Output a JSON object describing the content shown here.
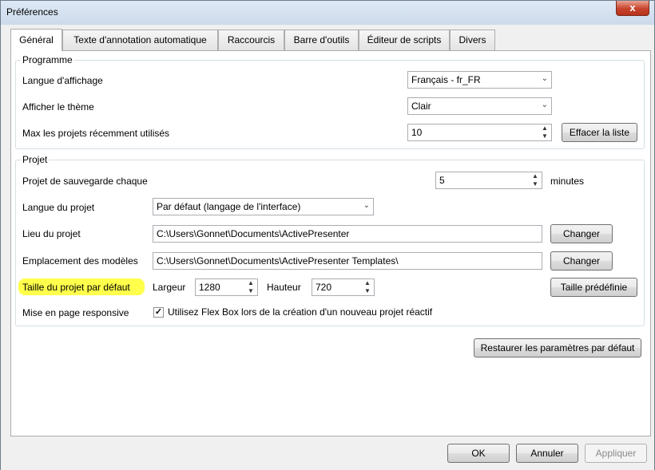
{
  "window": {
    "title": "Préférences",
    "close_glyph": "x"
  },
  "tabs": [
    {
      "label": "Général",
      "active": true
    },
    {
      "label": "Texte d'annotation automatique",
      "active": false
    },
    {
      "label": "Raccourcis",
      "active": false
    },
    {
      "label": "Barre d'outils",
      "active": false
    },
    {
      "label": "Éditeur de scripts",
      "active": false
    },
    {
      "label": "Divers",
      "active": false
    }
  ],
  "programme": {
    "legend": "Programme",
    "display_language": {
      "label": "Langue d'affichage",
      "value": "Français - fr_FR"
    },
    "theme": {
      "label": "Afficher le thème",
      "value": "Clair"
    },
    "recent_projects": {
      "label": "Max les projets récemment utilisés",
      "value": "10"
    },
    "clear_list_label": "Effacer la liste"
  },
  "projet": {
    "legend": "Projet",
    "autosave": {
      "label": "Projet de sauvegarde chaque",
      "value": "5",
      "unit": "minutes"
    },
    "project_language": {
      "label": "Langue du projet",
      "value": "Par défaut (langage de l'interface)"
    },
    "project_location": {
      "label": "Lieu du projet",
      "value": "C:\\Users\\Gonnet\\Documents\\ActivePresenter",
      "button": "Changer"
    },
    "templates_location": {
      "label": "Emplacement des modèles",
      "value": "C:\\Users\\Gonnet\\Documents\\ActivePresenter Templates\\",
      "button": "Changer"
    },
    "default_size": {
      "label": "Taille du projet par défaut",
      "width_label": "Largeur",
      "width_value": "1280",
      "height_label": "Hauteur",
      "height_value": "720",
      "preset_button": "Taille prédéfinie"
    },
    "responsive": {
      "label": "Mise en page responsive",
      "checkbox_label": "Utilisez Flex Box lors de la création d'un nouveau projet réactif",
      "checked": true
    }
  },
  "restore_defaults_label": "Restaurer les paramètres par défaut",
  "footer": {
    "ok_label": "OK",
    "cancel_label": "Annuler",
    "apply_label": "Appliquer"
  },
  "colors": {
    "highlight": "#ffff00",
    "close_button": "#c7432b"
  },
  "icons": {
    "dropdown": "chevron-down-icon",
    "spin_up": "chevron-up-icon",
    "spin_down": "chevron-down-icon",
    "check": "check-icon"
  }
}
